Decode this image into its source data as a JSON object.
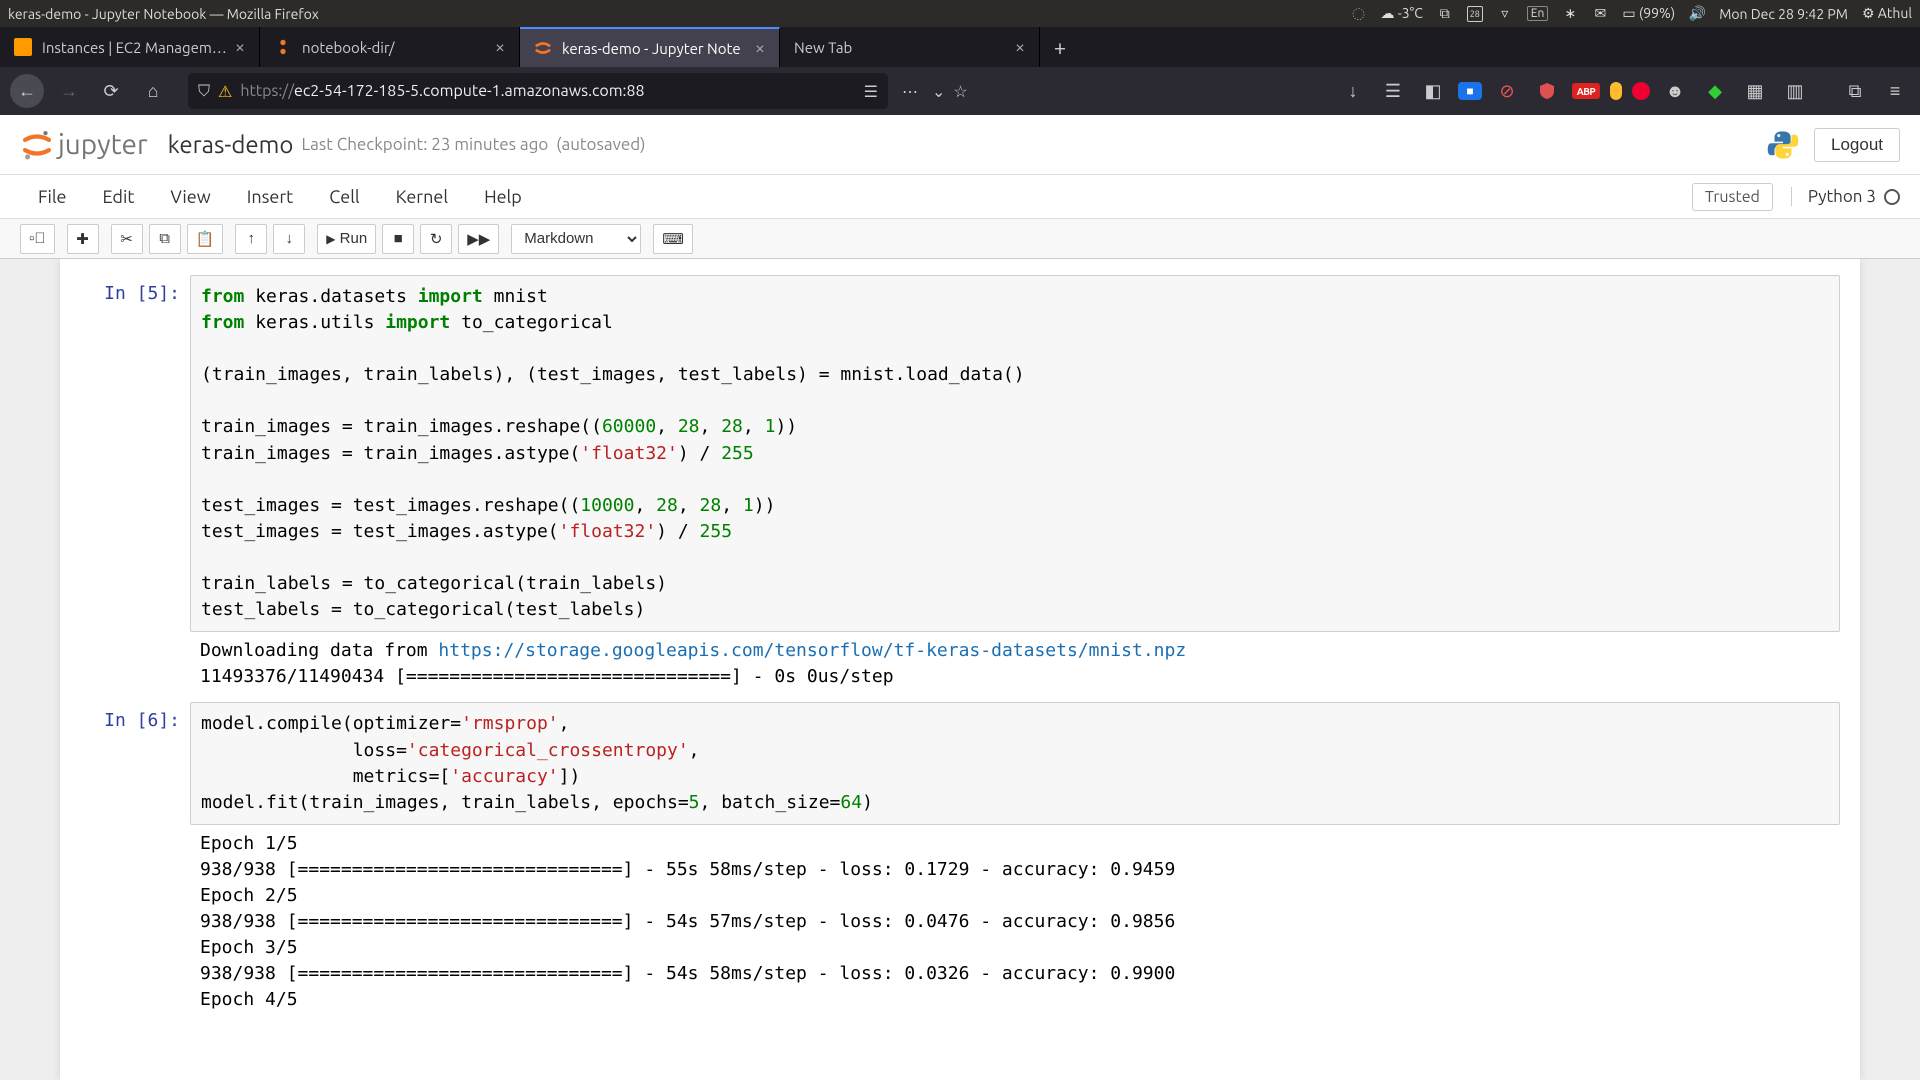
{
  "sysbar": {
    "title": "keras-demo - Jupyter Notebook — Mozilla Firefox",
    "temp": "-3°C",
    "date_day": "28",
    "lang": "En",
    "battery": "(99%)",
    "clock": "Mon Dec 28  9:42 PM",
    "user": "Athul"
  },
  "tabs": [
    {
      "label": "Instances | EC2 Management"
    },
    {
      "label": "notebook-dir/"
    },
    {
      "label": "keras-demo - Jupyter Note"
    },
    {
      "label": "New Tab"
    }
  ],
  "urlbar": {
    "prefix": "https://",
    "url_rest": "ec2-54-172-185-5.compute-1.amazonaws.com:88"
  },
  "jupyter": {
    "brand": "jupyter",
    "title": "keras-demo",
    "checkpoint": "Last Checkpoint: 23 minutes ago",
    "autosave": "(autosaved)",
    "logout": "Logout",
    "menu": [
      "File",
      "Edit",
      "View",
      "Insert",
      "Cell",
      "Kernel",
      "Help"
    ],
    "trusted": "Trusted",
    "kernel": "Python 3",
    "run_label": "Run",
    "celltype": "Markdown"
  },
  "cells": [
    {
      "prompt": "In [5]:",
      "code_html": "<span class='kw'>from</span> keras.datasets <span class='kw'>import</span> mnist\n<span class='kw'>from</span> keras.utils <span class='kw'>import</span> to_categorical\n\n(train_images, train_labels), (test_images, test_labels) = mnist.load_data()\n\ntrain_images = train_images.reshape((<span class='num'>60000</span>, <span class='num'>28</span>, <span class='num'>28</span>, <span class='num'>1</span>))\ntrain_images = train_images.astype(<span class='str'>'float32'</span>) / <span class='num'>255</span>\n\ntest_images = test_images.reshape((<span class='num'>10000</span>, <span class='num'>28</span>, <span class='num'>28</span>, <span class='num'>1</span>))\ntest_images = test_images.astype(<span class='str'>'float32'</span>) / <span class='num'>255</span>\n\ntrain_labels = to_categorical(train_labels)\ntest_labels = to_categorical(test_labels)",
      "output_html": "Downloading data from <a href='#'>https://storage.googleapis.com/tensorflow/tf-keras-datasets/mnist.npz</a>\n11493376/11490434 [==============================] - 0s 0us/step"
    },
    {
      "prompt": "In [6]:",
      "code_html": "model.compile(optimizer=<span class='str'>'rmsprop'</span>,\n              loss=<span class='str'>'categorical_crossentropy'</span>,\n              metrics=[<span class='str'>'accuracy'</span>])\nmodel.fit(train_images, train_labels, epochs=<span class='num'>5</span>, batch_size=<span class='num'>64</span>)",
      "output_html": "Epoch 1/5\n938/938 [==============================] - 55s 58ms/step - loss: 0.1729 - accuracy: 0.9459\nEpoch 2/5\n938/938 [==============================] - 54s 57ms/step - loss: 0.0476 - accuracy: 0.9856\nEpoch 3/5\n938/938 [==============================] - 54s 58ms/step - loss: 0.0326 - accuracy: 0.9900\nEpoch 4/5"
    }
  ]
}
